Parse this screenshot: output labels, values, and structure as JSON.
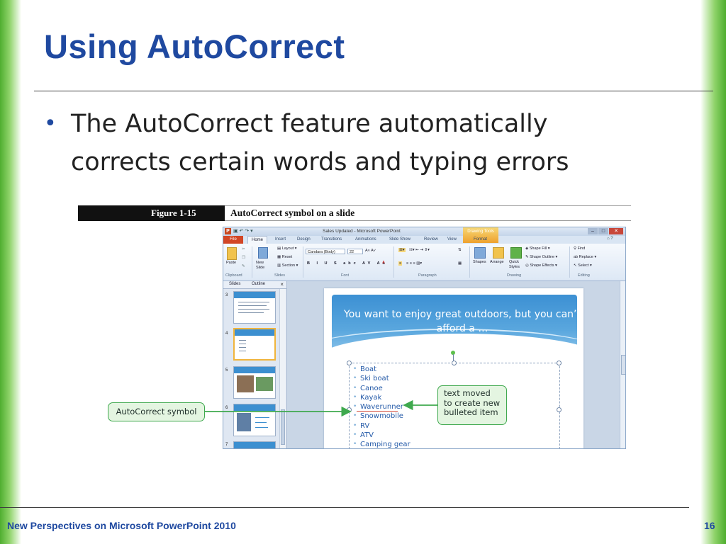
{
  "slide": {
    "title": "Using AutoCorrect",
    "bullet": "The AutoCorrect feature automatically corrects certain words and typing errors",
    "footer": "New Perspectives on Microsoft PowerPoint 2010",
    "page_number": "16",
    "accent_color": "#1f49a0",
    "side_color": "#4fae2f"
  },
  "figure": {
    "number": "Figure 1-15",
    "caption": "AutoCorrect symbol on a slide"
  },
  "ppt": {
    "window_title": "Sales Updated - Microsoft PowerPoint",
    "contextual_tab": "Drawing Tools",
    "tabs": [
      "File",
      "Home",
      "Insert",
      "Design",
      "Transitions",
      "Animations",
      "Slide Show",
      "Review",
      "View",
      "Format"
    ],
    "ribbon": {
      "paste": "Paste",
      "new_slide": "New Slide",
      "layout": "Layout",
      "reset": "Reset",
      "section": "Section",
      "font_name": "Candara (Body)",
      "font_size": "22",
      "shapes": "Shapes",
      "arrange": "Arrange",
      "quick_styles": "Quick Styles",
      "shape_fill": "Shape Fill",
      "shape_outline": "Shape Outline",
      "shape_effects": "Shape Effects",
      "find": "Find",
      "replace": "Replace",
      "select": "Select",
      "groups": [
        "Clipboard",
        "Slides",
        "Font",
        "Paragraph",
        "Drawing",
        "Editing"
      ]
    },
    "panel_tabs": [
      "Slides",
      "Outline"
    ],
    "thumbnails": [
      "3",
      "4",
      "5",
      "6",
      "7"
    ],
    "slide_title": "You want to enjoy great outdoors, but you can’t afford a …",
    "slide_items": [
      "Boat",
      "Ski boat",
      "Canoe",
      "Kayak",
      "Waverunner",
      "Snowmobile",
      "RV",
      "ATV",
      "Camping gear"
    ]
  },
  "callouts": {
    "left": "AutoCorrect symbol",
    "right": "text moved to create new bulleted item",
    "color": "#3fa94e"
  }
}
